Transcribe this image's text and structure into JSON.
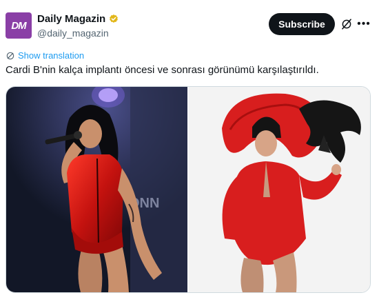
{
  "author": {
    "display_name": "Daily Magazin",
    "handle": "@daily_magazin",
    "avatar_text": "DM",
    "avatar_color": "#8a3fa6",
    "verified_color": "#e2b719"
  },
  "actions": {
    "subscribe_label": "Subscribe",
    "grok_icon": "grok-icon",
    "more_icon": "more-icon"
  },
  "translation": {
    "label": "Show translation",
    "icon": "translate-icon"
  },
  "tweet": {
    "text": "Cardi B'nin kalça implantı öncesi ve sonrası görünümü karşılaştırıldı."
  },
  "media": {
    "photos": [
      {
        "description_icon": "photo-before"
      },
      {
        "description_icon": "photo-after"
      }
    ],
    "colors": {
      "accent_red": "#d81e1e",
      "link_blue": "#1d9bf0"
    }
  }
}
